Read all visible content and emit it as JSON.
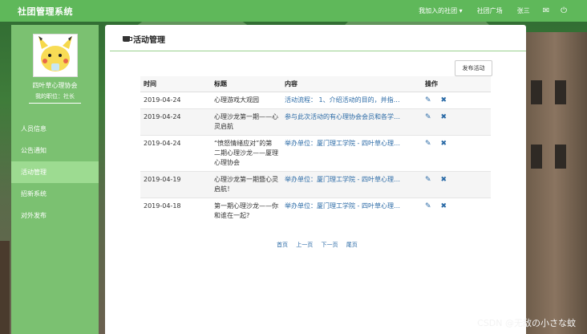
{
  "brand": "社团管理系统",
  "topnav": {
    "my_clubs": "我加入的社团 ▾",
    "plaza": "社团广场",
    "user": "张三",
    "mail_icon": "envelope-icon",
    "logout_icon": "logout-icon"
  },
  "sidebar": {
    "org_name": "四叶草心理协会",
    "role": "我的职位：社长",
    "items": [
      {
        "label": "人员信息"
      },
      {
        "label": "公告通知"
      },
      {
        "label": "活动管理"
      },
      {
        "label": "招新系统"
      },
      {
        "label": "对外发布"
      }
    ],
    "active_index": 2
  },
  "panel": {
    "title": "活动管理",
    "add_button": "发布活动",
    "columns": {
      "time": "时间",
      "title": "标题",
      "content": "内容",
      "ops": "操作"
    },
    "rows": [
      {
        "time": "2019-04-24",
        "title": "心理游戏大观园",
        "content": "活动流程： 1、介绍活动的目的，并指…"
      },
      {
        "time": "2019-04-24",
        "title": "心理沙龙第一期——心灵启航",
        "content": "参与此次活动的有心理协会会员和各学…"
      },
      {
        "time": "2019-04-24",
        "title": "“愤怒情绪应对”的第二期心理沙龙——厦理心理协会",
        "content": "举办单位：厦门理工学院 - 四叶草心理…"
      },
      {
        "time": "2019-04-19",
        "title": "心理沙龙第一期暨心灵启航！",
        "content": "举办单位：厦门理工学院 - 四叶草心理…"
      },
      {
        "time": "2019-04-18",
        "title": "第一期心理沙龙——你和谁在一起?",
        "content": "举办单位：厦门理工学院 - 四叶草心理…"
      }
    ],
    "pager": {
      "first": "首页",
      "prev": "上一页",
      "next": "下一页",
      "last": "尾页"
    }
  },
  "watermark": "CSDN @无敌の小さな蚊"
}
